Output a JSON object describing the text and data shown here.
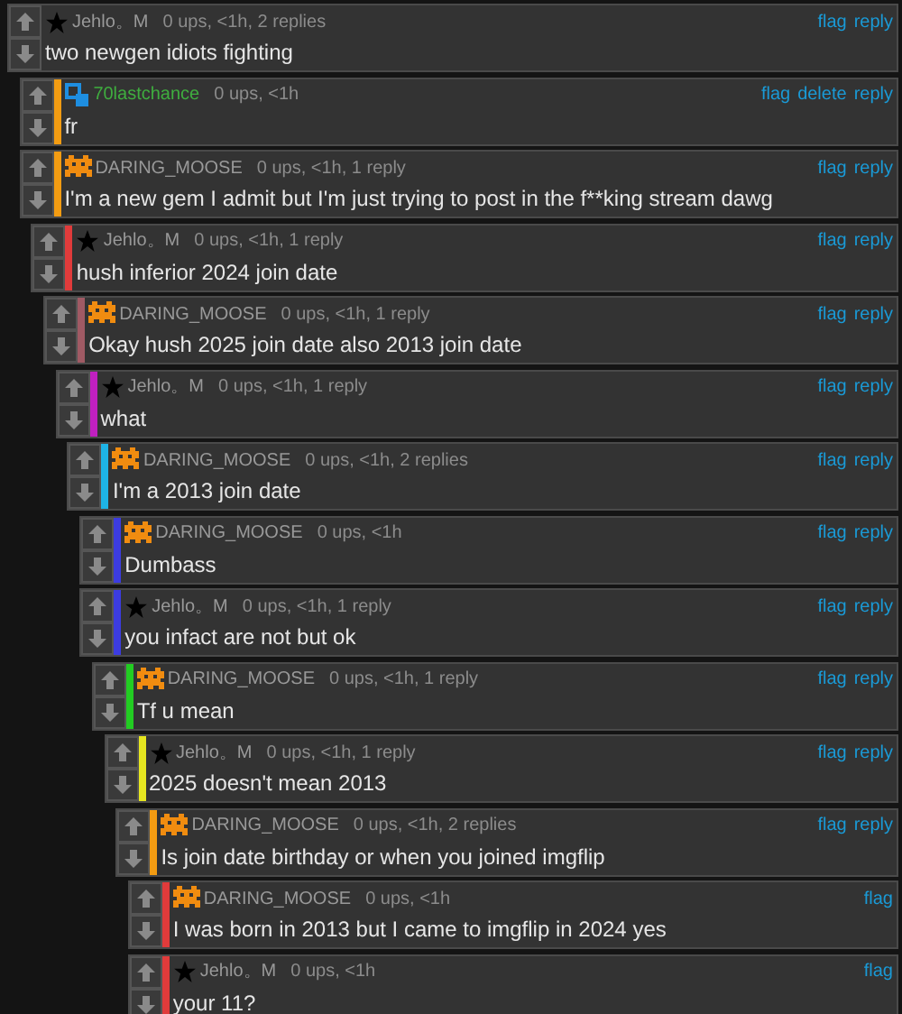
{
  "comments": [
    {
      "kind": "star",
      "user": {
        "name": "Jehlo。M",
        "color": "#999999"
      },
      "meta": "0 ups, <1h, 2 replies",
      "actions": [
        "flag",
        "reply"
      ],
      "text": "two newgen idiots fighting",
      "children": [
        {
          "kind": "squares",
          "user": {
            "name": "70lastchance",
            "color": "#3fae3f"
          },
          "meta": "0 ups, <1h",
          "actions": [
            "flag",
            "delete",
            "reply"
          ],
          "text": "fr",
          "color": "#f39c12"
        },
        {
          "kind": "invader",
          "user": {
            "name": "DARING_MOOSE",
            "color": "#999999"
          },
          "meta": "0 ups, <1h, 1 reply",
          "actions": [
            "flag",
            "reply"
          ],
          "text": "I'm a new gem I admit but I'm just trying to post in the f**king stream dawg",
          "color": "#f39c12",
          "children": [
            {
              "kind": "star",
              "user": {
                "name": "Jehlo。M",
                "color": "#999999"
              },
              "meta": "0 ups, <1h, 1 reply",
              "actions": [
                "flag",
                "reply"
              ],
              "text": "hush inferior 2024 join date",
              "color": "#e03b3b",
              "children": [
                {
                  "kind": "invader",
                  "user": {
                    "name": "DARING_MOOSE",
                    "color": "#999999"
                  },
                  "meta": "0 ups, <1h, 1 reply",
                  "actions": [
                    "flag",
                    "reply"
                  ],
                  "text": "Okay hush 2025 join date also 2013 join date",
                  "color": "#a05a64",
                  "children": [
                    {
                      "kind": "star",
                      "user": {
                        "name": "Jehlo。M",
                        "color": "#999999"
                      },
                      "meta": "0 ups, <1h, 1 reply",
                      "actions": [
                        "flag",
                        "reply"
                      ],
                      "text": "what",
                      "color": "#c020c0",
                      "children": [
                        {
                          "kind": "invader",
                          "user": {
                            "name": "DARING_MOOSE",
                            "color": "#999999"
                          },
                          "meta": "0 ups, <1h, 2 replies",
                          "actions": [
                            "flag",
                            "reply"
                          ],
                          "text": "I'm a 2013 join date",
                          "color": "#1eb4e6",
                          "children": [
                            {
                              "kind": "invader",
                              "user": {
                                "name": "DARING_MOOSE",
                                "color": "#999999"
                              },
                              "meta": "0 ups, <1h",
                              "actions": [
                                "flag",
                                "reply"
                              ],
                              "text": "Dumbass",
                              "color": "#3c3ce0"
                            },
                            {
                              "kind": "star",
                              "user": {
                                "name": "Jehlo。M",
                                "color": "#999999"
                              },
                              "meta": "0 ups, <1h, 1 reply",
                              "actions": [
                                "flag",
                                "reply"
                              ],
                              "text": "you infact are not but ok",
                              "color": "#3c3ce0",
                              "children": [
                                {
                                  "kind": "invader",
                                  "user": {
                                    "name": "DARING_MOOSE",
                                    "color": "#999999"
                                  },
                                  "meta": "0 ups, <1h, 1 reply",
                                  "actions": [
                                    "flag",
                                    "reply"
                                  ],
                                  "text": "Tf u mean",
                                  "color": "#22cc22",
                                  "children": [
                                    {
                                      "kind": "star",
                                      "user": {
                                        "name": "Jehlo。M",
                                        "color": "#999999"
                                      },
                                      "meta": "0 ups, <1h, 1 reply",
                                      "actions": [
                                        "flag",
                                        "reply"
                                      ],
                                      "text": "2025 doesn't mean 2013",
                                      "color": "#e6e620",
                                      "children": [
                                        {
                                          "kind": "invader",
                                          "user": {
                                            "name": "DARING_MOOSE",
                                            "color": "#999999"
                                          },
                                          "meta": "0 ups, <1h, 2 replies",
                                          "actions": [
                                            "flag",
                                            "reply"
                                          ],
                                          "text": "Is join date birthday or when you joined imgflip",
                                          "color": "#f39c12",
                                          "children": [
                                            {
                                              "kind": "invader",
                                              "user": {
                                                "name": "DARING_MOOSE",
                                                "color": "#999999"
                                              },
                                              "meta": "0 ups, <1h",
                                              "actions": [
                                                "flag"
                                              ],
                                              "text": "I was born in 2013 but I came to imgflip in 2024 yes",
                                              "color": "#e03b3b"
                                            },
                                            {
                                              "kind": "star",
                                              "user": {
                                                "name": "Jehlo。M",
                                                "color": "#999999"
                                              },
                                              "meta": "0 ups, <1h",
                                              "actions": [
                                                "flag"
                                              ],
                                              "text": "your 11?",
                                              "color": "#e03b3b"
                                            }
                                          ]
                                        }
                                      ]
                                    }
                                  ]
                                }
                              ]
                            }
                          ]
                        }
                      ]
                    }
                  ]
                }
              ]
            }
          ]
        }
      ]
    }
  ]
}
